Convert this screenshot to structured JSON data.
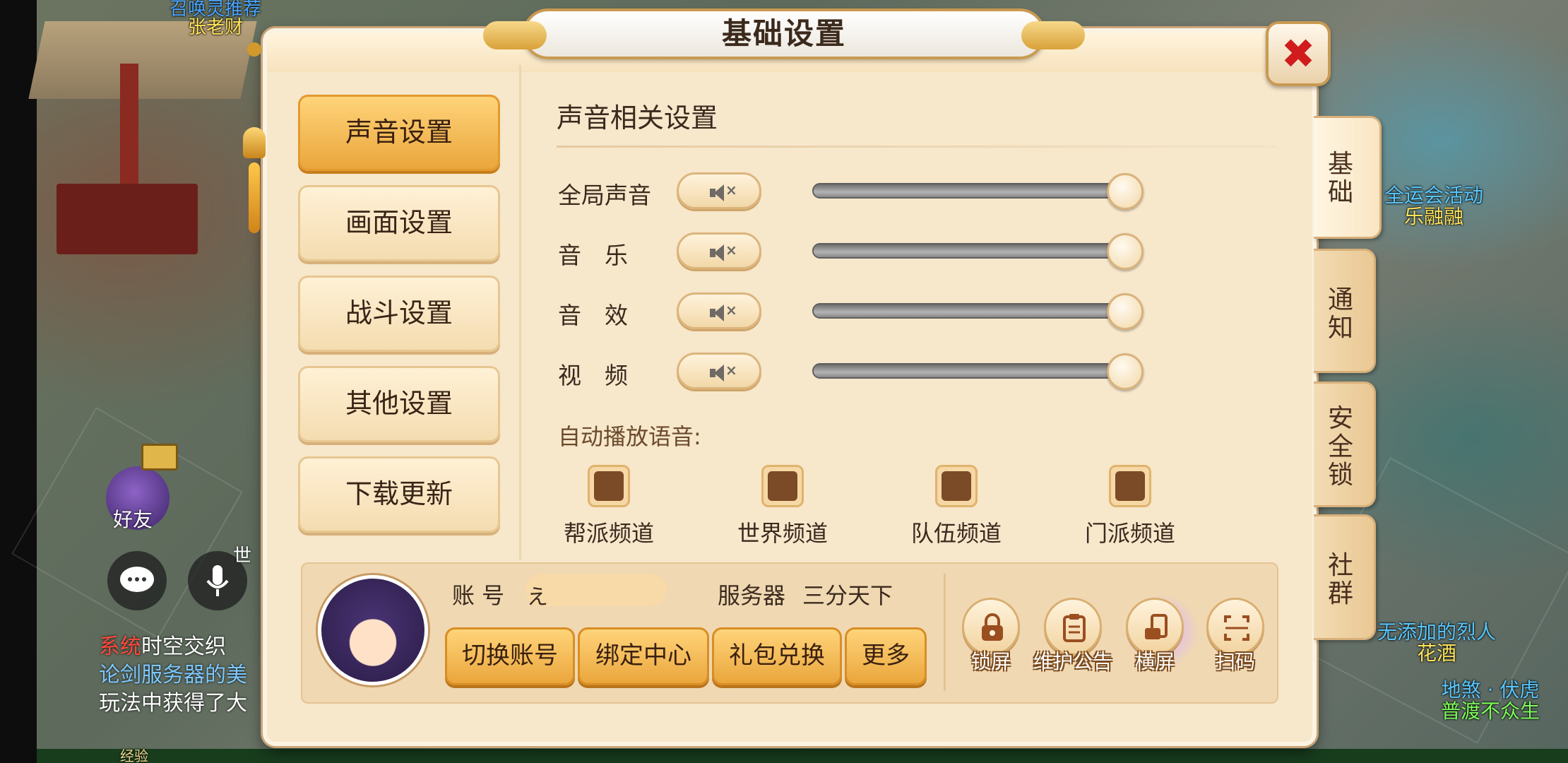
{
  "background": {
    "npc_top": {
      "line1": "召唤灵推荐",
      "line2": "张老财"
    },
    "npc_right": {
      "line1": "全运会活动",
      "line2": "乐融融"
    },
    "npc_bottom_right_1": {
      "line1": "无添加的烈人",
      "line2": "花酒"
    },
    "npc_bottom_right_2": {
      "line1": "地煞 · 伏虎",
      "line2": "普渡不众生"
    },
    "friend_label": "好友",
    "mic_label": "世",
    "chat_lines": [
      {
        "tag": "系统",
        "text": "时空交织"
      },
      {
        "text": "论剑服务器的美"
      },
      {
        "text": "玩法中获得了大"
      }
    ],
    "exp_label": "经验"
  },
  "dialog": {
    "title": "基础设置",
    "close_label": "✖",
    "nav": [
      {
        "label": "声音设置",
        "active": true
      },
      {
        "label": "画面设置",
        "active": false
      },
      {
        "label": "战斗设置",
        "active": false
      },
      {
        "label": "其他设置",
        "active": false
      },
      {
        "label": "下载更新",
        "active": false
      }
    ],
    "section_title": "声音相关设置",
    "volume_rows": [
      {
        "label": "全局声音",
        "muted": true,
        "level": 1.0
      },
      {
        "label": "音　乐",
        "muted": true,
        "level": 1.0
      },
      {
        "label": "音　效",
        "muted": true,
        "level": 1.0
      },
      {
        "label": "视　频",
        "muted": true,
        "level": 1.0
      }
    ],
    "auto_play_label": "自动播放语音:",
    "channels": [
      {
        "label": "帮派频道",
        "checked": false
      },
      {
        "label": "世界频道",
        "checked": false
      },
      {
        "label": "队伍频道",
        "checked": false
      },
      {
        "label": "门派频道",
        "checked": false
      }
    ],
    "account": {
      "account_label": "账 号",
      "account_value_visible": "え",
      "server_label": "服务器",
      "server_value": "三分天下"
    },
    "actions": [
      {
        "label": "切换账号"
      },
      {
        "label": "绑定中心"
      },
      {
        "label": "礼包兑换"
      },
      {
        "label": "更多"
      }
    ],
    "quick_buttons": [
      {
        "label": "锁屏",
        "icon": "lock-icon"
      },
      {
        "label": "维护公告",
        "icon": "clipboard-icon"
      },
      {
        "label": "横屏",
        "icon": "rotate-screen-icon"
      },
      {
        "label": "扫码",
        "icon": "scan-icon"
      }
    ],
    "side_tabs": [
      {
        "label": "基础",
        "active": true
      },
      {
        "label": "通知",
        "active": false
      },
      {
        "label": "安全锁",
        "active": false
      },
      {
        "label": "社群",
        "active": false
      }
    ]
  }
}
